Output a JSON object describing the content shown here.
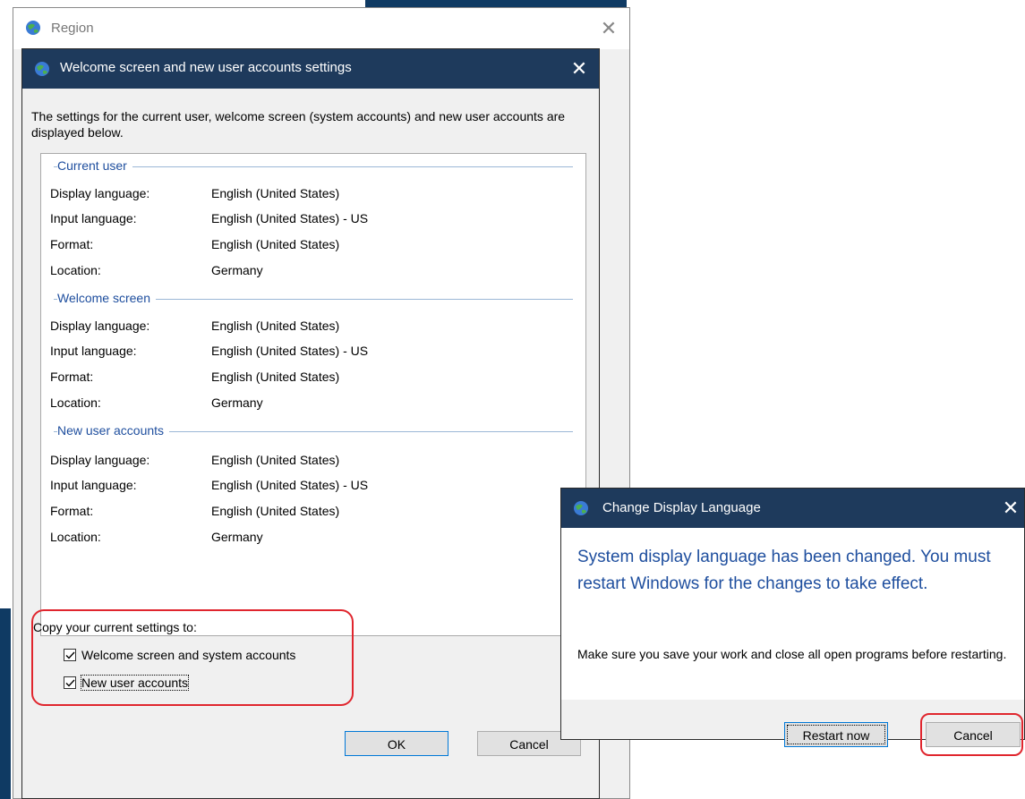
{
  "region_window": {
    "title": "Region",
    "close_label": "✕"
  },
  "welcome_dialog": {
    "title": "Welcome screen and new user accounts settings",
    "close_label": "✕",
    "intro": "The settings for the current user, welcome screen (system accounts) and new user accounts are displayed below.",
    "groups": [
      {
        "heading": "Current user",
        "rows": [
          {
            "label": "Display language:",
            "value": "English (United States)"
          },
          {
            "label": "Input language:",
            "value": "English (United States) - US"
          },
          {
            "label": "Format:",
            "value": "English (United States)"
          },
          {
            "label": "Location:",
            "value": "Germany"
          }
        ]
      },
      {
        "heading": "Welcome screen",
        "rows": [
          {
            "label": "Display language:",
            "value": "English (United States)"
          },
          {
            "label": "Input language:",
            "value": "English (United States) - US"
          },
          {
            "label": "Format:",
            "value": "English (United States)"
          },
          {
            "label": "Location:",
            "value": "Germany"
          }
        ]
      },
      {
        "heading": "New user accounts",
        "rows": [
          {
            "label": "Display language:",
            "value": "English (United States)"
          },
          {
            "label": "Input language:",
            "value": "English (United States) - US"
          },
          {
            "label": "Format:",
            "value": "English (United States)"
          },
          {
            "label": "Location:",
            "value": "Germany"
          }
        ]
      }
    ],
    "copy_label": "Copy your current settings to:",
    "checkboxes": [
      {
        "label": "Welcome screen and system accounts",
        "checked": true
      },
      {
        "label": "New user accounts",
        "checked": true
      }
    ],
    "ok_label": "OK",
    "cancel_label": "Cancel"
  },
  "change_display_language": {
    "title": "Change Display Language",
    "close_label": "✕",
    "main_message": "System display language has been changed. You must restart Windows for the changes to take effect.",
    "sub_message": "Make sure you save your work and close all open programs before restarting.",
    "restart_label": "Restart now",
    "cancel_label": "Cancel"
  },
  "colors": {
    "titlebar": "#1e3a5c",
    "accent_text": "#1e4e9e",
    "highlight": "#e0262e"
  }
}
